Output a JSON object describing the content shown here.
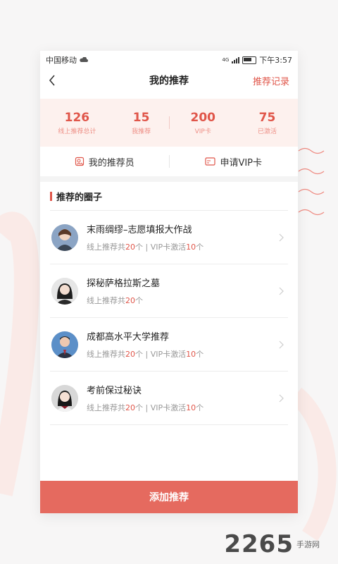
{
  "status_bar": {
    "carrier": "中国移动",
    "time": "下午3:57",
    "network": "4G"
  },
  "header": {
    "title": "我的推荐",
    "right_link": "推荐记录"
  },
  "stats": [
    {
      "value": "126",
      "label": "线上推荐总计"
    },
    {
      "value": "15",
      "label": "我推荐"
    },
    {
      "value": "200",
      "label": "VIP卡"
    },
    {
      "value": "75",
      "label": "已激活"
    }
  ],
  "actions": [
    {
      "label": "我的推荐员",
      "icon": "recommender-icon"
    },
    {
      "label": "申请VIP卡",
      "icon": "vip-card-icon"
    }
  ],
  "section": {
    "title": "推荐的圈子"
  },
  "circles": [
    {
      "name": "末雨绸缪–志愿填报大作战",
      "online_prefix": "线上推荐共",
      "online_count": "20",
      "unit": "个",
      "sep": " | ",
      "vip_prefix": "VIP卡激活",
      "vip_count": "10",
      "vip_unit": "个"
    },
    {
      "name": "探秘萨格拉斯之墓",
      "online_prefix": "线上推荐共",
      "online_count": "20",
      "unit": "个"
    },
    {
      "name": "成都高水平大学推荐",
      "online_prefix": "线上推荐共",
      "online_count": "20",
      "unit": "个",
      "sep": " | ",
      "vip_prefix": "VIP卡激活",
      "vip_count": "10",
      "vip_unit": "个"
    },
    {
      "name": "考前保过秘诀",
      "online_prefix": "线上推荐共",
      "online_count": "20",
      "unit": "个",
      "sep": " | ",
      "vip_prefix": "VIP卡激活",
      "vip_count": "10",
      "vip_unit": "个"
    }
  ],
  "footer_button": "添加推荐",
  "watermark": {
    "number": "2265",
    "site": "手游网"
  },
  "colors": {
    "accent": "#e0564a",
    "button": "#e56a5f",
    "stats_bg": "#fdf1ee"
  }
}
